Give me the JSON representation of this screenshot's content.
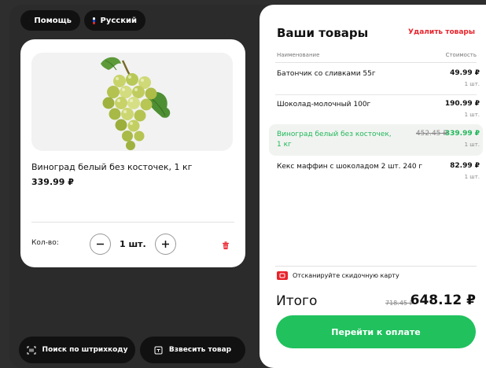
{
  "header": {
    "help_label": "Помощь",
    "language_label": "Русский"
  },
  "product": {
    "name": "Виноград белый без косточек, 1 кг",
    "price": "339.99 ₽",
    "quantity_label": "Кол-во:",
    "quantity_value": "1 шт."
  },
  "bottom_actions": {
    "barcode_search_label": "Поиск по штрихкоду",
    "weigh_label": "Взвесить товар"
  },
  "cart": {
    "title": "Ваши товары",
    "delete_label": "Удалить товары",
    "column_name": "Наименование",
    "column_cost": "Стоимость",
    "items": [
      {
        "name": "Батончик со сливками 55г",
        "price": "49.99 ₽",
        "old_price": "",
        "qty": "1 шт."
      },
      {
        "name": "Шоколад-молочный 100г",
        "price": "190.99 ₽",
        "old_price": "",
        "qty": "1 шт."
      },
      {
        "name_line1": "Виноград белый без косточек,",
        "name_line2": "1 кг",
        "price": "339.99 ₽",
        "old_price": "452.45 ₽",
        "qty": "1 шт."
      },
      {
        "name": "Кекс маффин с шоколадом 2 шт. 240 г",
        "price": "82.99 ₽",
        "old_price": "",
        "qty": "1 шт."
      }
    ],
    "scan_card_label": "Отсканируйте скидочную карту",
    "total_label": "Итого",
    "total_old": "718.45 ₽",
    "total_new": "648.12 ₽",
    "pay_label": "Перейти к оплате"
  },
  "colors": {
    "accent_green": "#21c15e",
    "accent_red": "#e8232b",
    "panel_dark": "#2b2b2b"
  }
}
